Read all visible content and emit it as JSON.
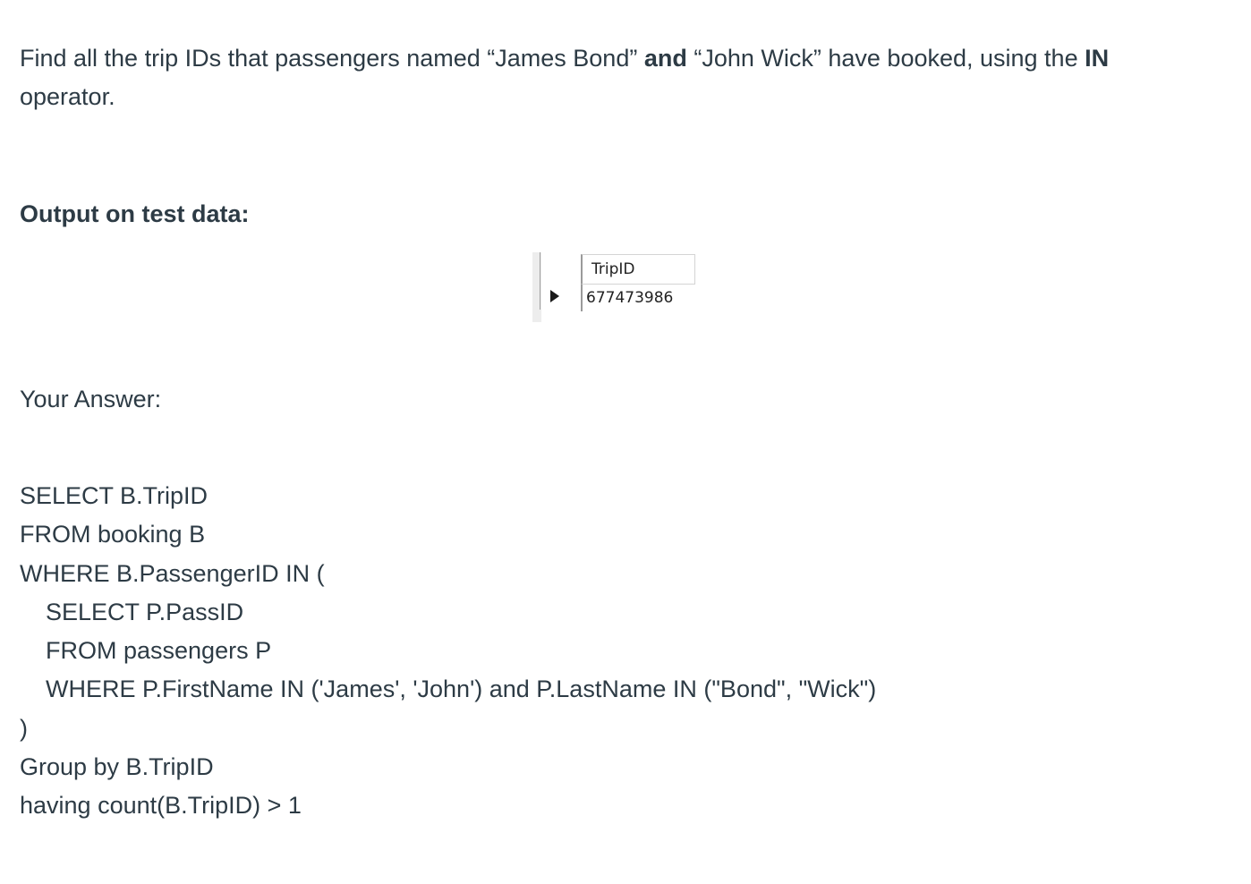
{
  "question": {
    "part1": "Find all the trip IDs that passengers named “James Bond” ",
    "bold1": "and",
    "part2": " “John Wick” have booked, using the ",
    "bold2": "IN",
    "part3": " operator."
  },
  "output_heading": "Output on test data:",
  "result_grid": {
    "column_header": "TripID",
    "rows": [
      "677473986"
    ]
  },
  "answer_label": "Your Answer:",
  "answer_code": [
    "SELECT B.TripID",
    "FROM booking B",
    "WHERE B.PassengerID IN (",
    "SELECT P.PassID",
    "FROM passengers P",
    "WHERE P.FirstName IN ('James', 'John') and P.LastName IN (\"Bond\", \"Wick\")",
    ")",
    "Group by B.TripID",
    "having count(B.TripID) > 1"
  ]
}
